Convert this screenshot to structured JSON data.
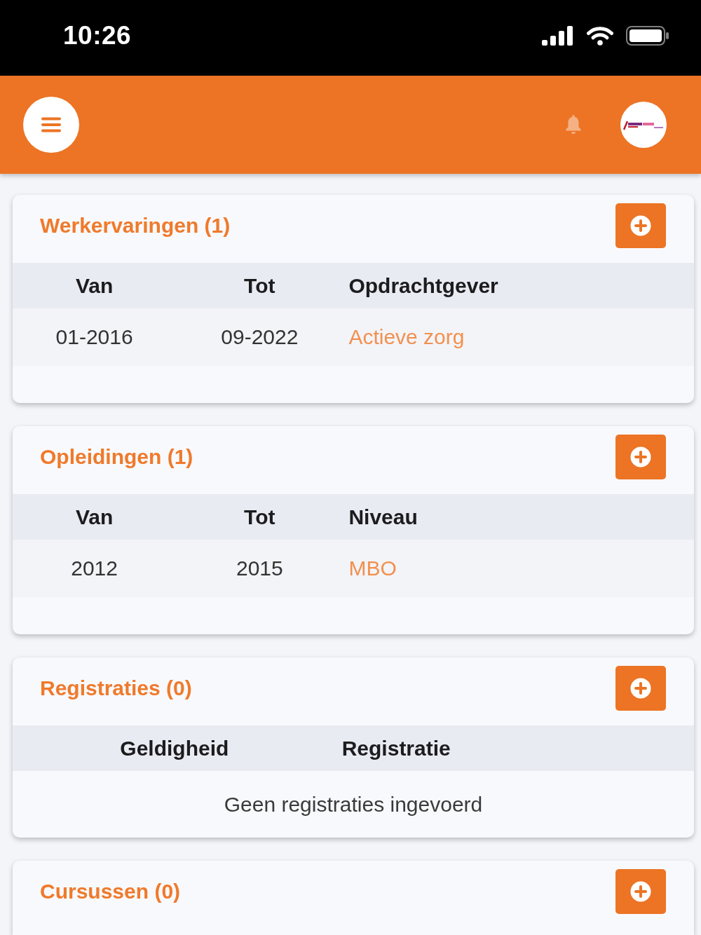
{
  "status_bar": {
    "time": "10:26"
  },
  "sections": [
    {
      "title": "Werkervaringen (1)",
      "columns": [
        "Van",
        "Tot",
        "Opdrachtgever"
      ],
      "rows": [
        {
          "cells": [
            {
              "kind": "text",
              "text": "01-2016"
            },
            {
              "kind": "text",
              "text": "09-2022"
            },
            {
              "kind": "link",
              "text": "Actieve zorg"
            }
          ]
        }
      ]
    },
    {
      "title": "Opleidingen (1)",
      "columns": [
        "Van",
        "Tot",
        "Niveau"
      ],
      "rows": [
        {
          "cells": [
            {
              "kind": "text",
              "text": "2012"
            },
            {
              "kind": "text",
              "text": "2015"
            },
            {
              "kind": "link",
              "text": "MBO"
            }
          ]
        }
      ]
    },
    {
      "title": "Registraties (0)",
      "columns": [
        "Geldigheid",
        "Registratie"
      ],
      "empty_message": "Geen registraties ingevoerd"
    },
    {
      "title": "Cursussen (0)"
    }
  ]
}
